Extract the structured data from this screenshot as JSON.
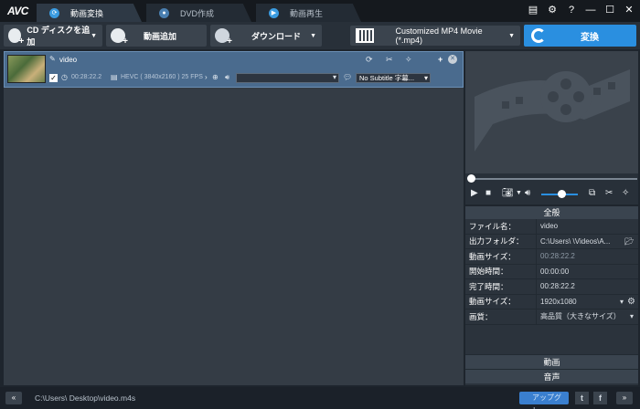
{
  "app": {
    "logo": "AVC"
  },
  "tabs": [
    {
      "label": "動画変換",
      "active": true
    },
    {
      "label": "DVD作成",
      "active": false
    },
    {
      "label": "動画再生",
      "active": false
    }
  ],
  "window_controls": [
    "list-icon",
    "gear-icon",
    "help-icon",
    "minimize-icon",
    "maximize-icon",
    "close-icon"
  ],
  "toolbar": {
    "cd_button": "CD ディスクを追加",
    "add_video_button": "動画追加",
    "download_button": "ダウンロード",
    "output_format": "Customized MP4 Movie (*.mp4)",
    "convert_button": "変換"
  },
  "file_item": {
    "name": "video",
    "duration": "00:28:22.2",
    "codec_info": "HEVC ( 3840x2160 ) 25 FPS",
    "subtitle": "No Subtitle 字幕...",
    "checked": true
  },
  "properties": {
    "header": "全般",
    "rows": [
      {
        "key": "ファイル名：",
        "value": "video",
        "dim": false
      },
      {
        "key": "出力フォルダ：",
        "value": "C:\\Users\\      \\Videos\\A...",
        "dim": false
      },
      {
        "key": "動画サイズ：",
        "value": "00:28:22.2",
        "dim": true
      },
      {
        "key": "開始時間：",
        "value": "00:00:00",
        "dim": false
      },
      {
        "key": "完了時間：",
        "value": "00:28:22.2",
        "dim": false
      },
      {
        "key": "動画サイズ：",
        "value": "1920x1080",
        "dim": false
      },
      {
        "key": "画質：",
        "value": "高品質（大きなサイズ）",
        "dim": false
      }
    ],
    "video_section": "動画",
    "audio_section": "音声"
  },
  "statusbar": {
    "path": "C:\\Users\\        Desktop\\video.m4s",
    "upgrade": "アップグレ..."
  },
  "colors": {
    "accent": "#2a8fe0",
    "selected_row": "#4a6b8e"
  }
}
